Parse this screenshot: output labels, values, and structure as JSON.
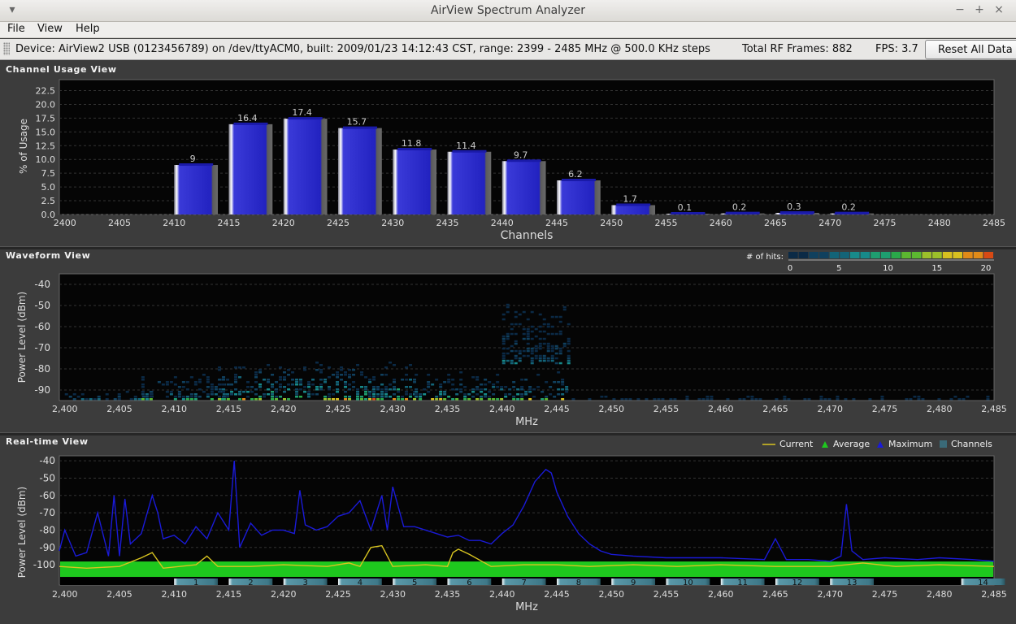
{
  "window": {
    "title": "AirView Spectrum Analyzer",
    "menu": [
      "File",
      "View",
      "Help"
    ]
  },
  "infobar": {
    "device": "Device: AirView2 USB (0123456789) on /dev/ttyACM0, built: 2009/01/23 14:12:43 CST, range: 2399 - 2485 MHz @ 500.0 KHz steps",
    "rf_frames": "Total RF Frames: 882",
    "fps": "FPS: 3.7",
    "reset_label": "Reset All Data"
  },
  "panels": {
    "channel_usage": {
      "title": "Channel Usage View",
      "ylabel": "% of Usage",
      "xlabel": "Channels"
    },
    "waveform": {
      "title": "Waveform View",
      "ylabel": "Power Level (dBm)",
      "xlabel": "MHz",
      "hits_label": "# of hits:",
      "hits_ticks": [
        "0",
        "5",
        "10",
        "15",
        "20"
      ]
    },
    "realtime": {
      "title": "Real-time View",
      "ylabel": "Power Level (dBm)",
      "xlabel": "MHz",
      "legend": [
        {
          "label": "Current",
          "color": "#d8c420"
        },
        {
          "label": "Average",
          "color": "#1ec81e"
        },
        {
          "label": "Maximum",
          "color": "#1a1ad8"
        },
        {
          "label": "Channels",
          "color": "#3a6a78"
        }
      ]
    }
  },
  "chart_data": [
    {
      "type": "bar",
      "title": "Channel Usage View",
      "xlabel": "Channels",
      "ylabel": "% of Usage",
      "x_ticks": [
        2400,
        2405,
        2410,
        2415,
        2420,
        2425,
        2430,
        2435,
        2440,
        2445,
        2450,
        2455,
        2460,
        2465,
        2470,
        2475,
        2480,
        2485
      ],
      "y_ticks": [
        0.0,
        2.5,
        5.0,
        7.5,
        10.0,
        12.5,
        15.0,
        17.5,
        20.0,
        22.5
      ],
      "xlim": [
        2399.5,
        2485
      ],
      "ylim": [
        0,
        24.5
      ],
      "bars": [
        {
          "channel": 1,
          "center": 2412,
          "value": 9,
          "label": "9"
        },
        {
          "channel": 2,
          "center": 2417,
          "value": 16.4,
          "label": "16.4"
        },
        {
          "channel": 3,
          "center": 2422,
          "value": 17.4,
          "label": "17.4"
        },
        {
          "channel": 4,
          "center": 2427,
          "value": 15.7,
          "label": "15.7"
        },
        {
          "channel": 5,
          "center": 2432,
          "value": 11.8,
          "label": "11.8"
        },
        {
          "channel": 6,
          "center": 2437,
          "value": 11.4,
          "label": "11.4"
        },
        {
          "channel": 7,
          "center": 2442,
          "value": 9.7,
          "label": "9.7"
        },
        {
          "channel": 8,
          "center": 2447,
          "value": 6.2,
          "label": "6.2"
        },
        {
          "channel": 9,
          "center": 2452,
          "value": 1.7,
          "label": "1.7"
        },
        {
          "channel": 10,
          "center": 2457,
          "value": 0.1,
          "label": "0.1"
        },
        {
          "channel": 11,
          "center": 2462,
          "value": 0.2,
          "label": "0.2"
        },
        {
          "channel": 12,
          "center": 2467,
          "value": 0.3,
          "label": "0.3"
        },
        {
          "channel": 13,
          "center": 2472,
          "value": 0.2,
          "label": "0.2"
        }
      ],
      "grid": true
    },
    {
      "type": "heatmap",
      "title": "Waveform View",
      "xlabel": "MHz",
      "ylabel": "Power Level (dBm)",
      "x_ticks": [
        "2,400",
        "2,405",
        "2,410",
        "2,415",
        "2,420",
        "2,425",
        "2,430",
        "2,435",
        "2,440",
        "2,445",
        "2,450",
        "2,455",
        "2,460",
        "2,465",
        "2,470",
        "2,475",
        "2,480",
        "2,485"
      ],
      "y_ticks": [
        -40,
        -50,
        -60,
        -70,
        -80,
        -90
      ],
      "xlim": [
        2399.5,
        2485
      ],
      "ylim": [
        -95,
        -35
      ],
      "colorbar": {
        "label": "# of hits:",
        "range": [
          0,
          20
        ],
        "ticks": [
          0,
          5,
          10,
          15,
          20
        ]
      },
      "clusters": [
        {
          "x0": 2400,
          "x1": 2408,
          "y0": -95,
          "y1": -90,
          "hits": 3
        },
        {
          "x0": 2407,
          "x1": 2415,
          "y0": -95,
          "y1": -82,
          "hits": 4
        },
        {
          "x0": 2414,
          "x1": 2432,
          "y0": -95,
          "y1": -76,
          "hits": 6
        },
        {
          "x0": 2432,
          "x1": 2446,
          "y0": -95,
          "y1": -80,
          "hits": 5
        },
        {
          "x0": 2440,
          "x1": 2446,
          "y0": -78,
          "y1": -45,
          "hits": 2
        },
        {
          "x0": 2446,
          "x1": 2485,
          "y0": -95,
          "y1": -92,
          "hits": 1
        }
      ],
      "grid": true
    },
    {
      "type": "line",
      "title": "Real-time View",
      "xlabel": "MHz",
      "ylabel": "Power Level (dBm)",
      "x_ticks": [
        "2,400",
        "2,405",
        "2,410",
        "2,415",
        "2,420",
        "2,425",
        "2,430",
        "2,435",
        "2,440",
        "2,445",
        "2,450",
        "2,455",
        "2,460",
        "2,465",
        "2,470",
        "2,475",
        "2,480",
        "2,485"
      ],
      "y_ticks": [
        -40,
        -50,
        -60,
        -70,
        -80,
        -90,
        -100
      ],
      "xlim": [
        2399.5,
        2485
      ],
      "ylim": [
        -107,
        -35
      ],
      "legend_position": "top-right",
      "series": [
        {
          "name": "Maximum",
          "color": "#1a1ad8",
          "x": [
            2399.5,
            2400,
            2401,
            2402,
            2403,
            2404,
            2404.5,
            2405,
            2405.5,
            2406,
            2407,
            2408,
            2408.5,
            2409,
            2410,
            2411,
            2412,
            2413,
            2414,
            2415,
            2415.5,
            2416,
            2417,
            2418,
            2419,
            2420,
            2421,
            2421.5,
            2422,
            2423,
            2424,
            2425,
            2426,
            2427,
            2428,
            2429,
            2429.5,
            2430,
            2431,
            2432,
            2433,
            2434,
            2435,
            2436,
            2437,
            2438,
            2439,
            2440,
            2441,
            2442,
            2443,
            2444,
            2444.5,
            2445,
            2446,
            2447,
            2448,
            2449,
            2450,
            2452,
            2455,
            2460,
            2464,
            2465,
            2466,
            2468,
            2470,
            2471,
            2471.5,
            2472,
            2473,
            2475,
            2478,
            2480,
            2483,
            2485
          ],
          "y": [
            -92,
            -80,
            -95,
            -93,
            -70,
            -95,
            -60,
            -95,
            -62,
            -88,
            -82,
            -60,
            -70,
            -85,
            -83,
            -88,
            -78,
            -85,
            -70,
            -80,
            -40,
            -90,
            -76,
            -83,
            -80,
            -80,
            -82,
            -57,
            -77,
            -80,
            -78,
            -72,
            -70,
            -63,
            -80,
            -60,
            -80,
            -55,
            -78,
            -78,
            -80,
            -82,
            -84,
            -83,
            -86,
            -86,
            -88,
            -82,
            -77,
            -66,
            -52,
            -45,
            -47,
            -58,
            -72,
            -82,
            -88,
            -92,
            -94,
            -95,
            -96,
            -96,
            -97,
            -85,
            -97,
            -97,
            -98,
            -95,
            -65,
            -92,
            -97,
            -96,
            -97,
            -96,
            -97,
            -98
          ]
        },
        {
          "name": "Current",
          "color": "#d8c420",
          "x": [
            2399.5,
            2402,
            2405,
            2407,
            2408,
            2409,
            2412,
            2413,
            2414,
            2417,
            2420,
            2424,
            2426,
            2427,
            2428,
            2429,
            2430,
            2433,
            2435,
            2435.5,
            2436,
            2437,
            2439,
            2442,
            2445,
            2448,
            2452,
            2456,
            2460,
            2465,
            2470,
            2473,
            2476,
            2480,
            2485
          ],
          "y": [
            -101,
            -102,
            -101,
            -96,
            -93,
            -102,
            -100,
            -95,
            -101,
            -101,
            -100,
            -101,
            -99,
            -101,
            -90,
            -89,
            -101,
            -100,
            -101,
            -93,
            -91,
            -94,
            -101,
            -100,
            -100,
            -101,
            -100,
            -101,
            -100,
            -101,
            -101,
            -99,
            -101,
            -100,
            -101
          ]
        },
        {
          "name": "Average",
          "color": "#1ec81e",
          "x": [
            2399.5,
            2485
          ],
          "y": [
            -100,
            -100
          ],
          "fill_to": -105
        }
      ],
      "channels": [
        "1",
        "2",
        "3",
        "4",
        "5",
        "6",
        "7",
        "8",
        "9",
        "10",
        "11",
        "12",
        "13",
        "14"
      ],
      "channel_centers": [
        2412,
        2417,
        2422,
        2427,
        2432,
        2437,
        2442,
        2447,
        2452,
        2457,
        2462,
        2467,
        2472,
        2484
      ],
      "grid": true
    }
  ]
}
